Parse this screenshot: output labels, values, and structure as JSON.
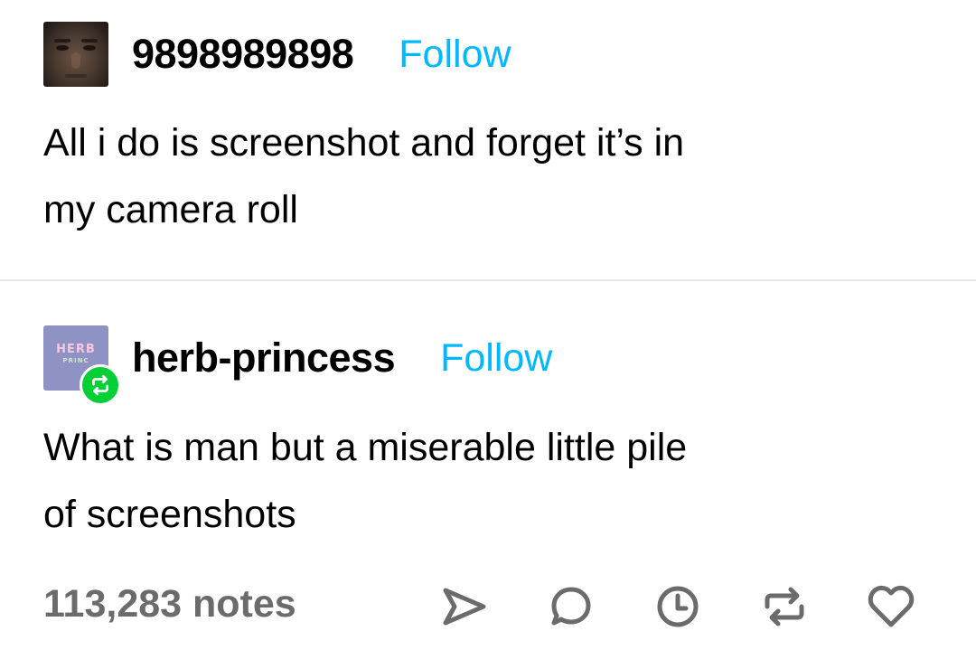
{
  "posts": [
    {
      "username": "9898989898",
      "follow_label": "Follow",
      "text_lines": [
        "All i do is screenshot and forget it’s in",
        "my camera roll"
      ]
    },
    {
      "username": "herb-princess",
      "follow_label": "Follow",
      "avatar_text": {
        "top": "HERB",
        "bottom": "PRINCESS"
      },
      "text_lines": [
        "What is man but a miserable little pile",
        "of screenshots"
      ]
    }
  ],
  "footer": {
    "notes": "113,283 notes",
    "actions": [
      "share-icon",
      "reply-icon",
      "queue-icon",
      "reblog-icon",
      "like-icon"
    ]
  },
  "colors": {
    "follow": "#00b8ff",
    "notes": "#6b6b6b",
    "reblog_badge": "#00cf35",
    "avatar_herb": "#8f93c4"
  }
}
